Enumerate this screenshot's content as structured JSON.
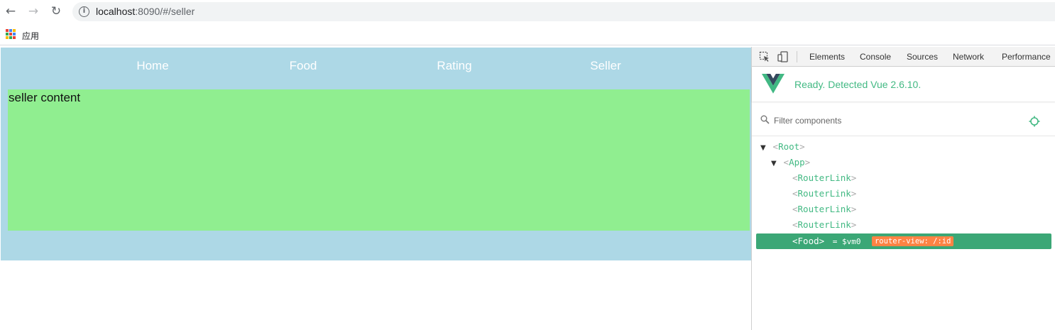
{
  "browser": {
    "back_glyph": "←",
    "forward_glyph": "→",
    "reload_glyph": "↻",
    "info_glyph": "i",
    "url_host": "localhost",
    "url_path": ":8090/#/seller",
    "bookmarks": {
      "apps_label": "应用"
    }
  },
  "app": {
    "nav": [
      "Home",
      "Food",
      "Rating",
      "Seller"
    ],
    "content_text": "seller content",
    "colors": {
      "background": "#add8e6",
      "content": "#90ee90"
    }
  },
  "devtools": {
    "tabs": [
      "Elements",
      "Console",
      "Sources",
      "Network",
      "Performance"
    ],
    "vue_status": "Ready. Detected Vue 2.6.10.",
    "filter_placeholder": "Filter components",
    "tree": [
      {
        "name": "Root",
        "toggle": "▼"
      },
      {
        "name": "App",
        "toggle": "▼"
      },
      {
        "name": "RouterLink"
      },
      {
        "name": "RouterLink"
      },
      {
        "name": "RouterLink"
      },
      {
        "name": "RouterLink"
      },
      {
        "name": "Food",
        "vm_ref": "= $vm0",
        "badge": "router-view: /:id"
      }
    ],
    "bracket_open": "<",
    "bracket_close": ">",
    "colors": {
      "vue_green": "#42b983",
      "selected": "#3ba776",
      "badge": "#ff8344"
    }
  }
}
